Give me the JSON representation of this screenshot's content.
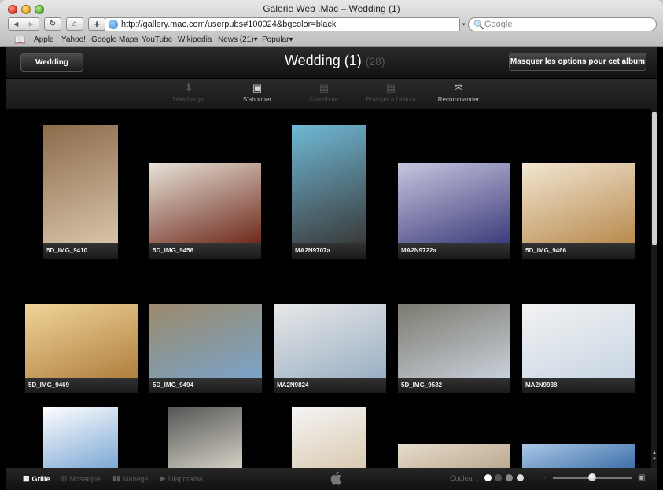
{
  "window": {
    "title": "Galerie Web .Mac – Wedding (1)"
  },
  "browser": {
    "url": "http://gallery.mac.com/userpubs#100024&bgcolor=black",
    "search_placeholder": "Google",
    "bookmarks": [
      "Apple",
      "Yahoo!",
      "Google Maps",
      "YouTube",
      "Wikipedia",
      "News (21)▾",
      "Popular▾"
    ]
  },
  "gallery": {
    "album_button": "Wedding",
    "title": "Wedding (1)",
    "count": "(28)",
    "hide_options_button": "Masquer les options pour cet album",
    "actions": [
      {
        "label": "Télécharger",
        "icon": "download-icon",
        "enabled": false
      },
      {
        "label": "S'abonner",
        "icon": "rss-icon",
        "enabled": true
      },
      {
        "label": "Contribuer",
        "icon": "contribute-icon",
        "enabled": false
      },
      {
        "label": "Envoyer à l'album",
        "icon": "send-icon",
        "enabled": false
      },
      {
        "label": "Recommander",
        "icon": "envelope-icon",
        "enabled": true
      }
    ],
    "photos": [
      {
        "caption": "5D_IMG_9410",
        "colors": [
          "#d8c4a8",
          "#8c6b4a"
        ]
      },
      {
        "caption": "5D_IMG_9456",
        "colors": [
          "#6e2a1c",
          "#e8e2d8"
        ]
      },
      {
        "caption": "MA2N9707a",
        "colors": [
          "#3a3a3a",
          "#6fb9d6"
        ]
      },
      {
        "caption": "MA2N9722a",
        "colors": [
          "#3d3c7a",
          "#c7c6e0"
        ]
      },
      {
        "caption": "5D_IMG_9466",
        "colors": [
          "#b88a4e",
          "#f2e6d2"
        ]
      },
      {
        "caption": "5D_IMG_9469",
        "colors": [
          "#b0803e",
          "#f0d49a"
        ]
      },
      {
        "caption": "5D_IMG_9494",
        "colors": [
          "#7aa3c8",
          "#9b8a6a"
        ]
      },
      {
        "caption": "MA2N9824",
        "colors": [
          "#9bb0c4",
          "#e8e8e8"
        ]
      },
      {
        "caption": "5D_IMG_9532",
        "colors": [
          "#c7cfd8",
          "#7c7a70"
        ]
      },
      {
        "caption": "MA2N9938",
        "colors": [
          "#c9d6e4",
          "#f2f2f2"
        ]
      },
      {
        "caption": "",
        "colors": [
          "#7aa6d4",
          "#ffffff"
        ]
      },
      {
        "caption": "",
        "colors": [
          "#d6d2c6",
          "#555555"
        ]
      },
      {
        "caption": "",
        "colors": [
          "#d9c9b0",
          "#f5f5f5"
        ]
      },
      {
        "caption": "",
        "colors": [
          "#b9a88e",
          "#e6dccb"
        ]
      },
      {
        "caption": "",
        "colors": [
          "#3c6ea8",
          "#a9c7e6"
        ]
      }
    ]
  },
  "bottombar": {
    "view_modes": [
      {
        "label": "Grille",
        "icon": "grid-icon",
        "active": true
      },
      {
        "label": "Mosaïque",
        "icon": "mosaic-icon",
        "active": false
      },
      {
        "label": "Manège",
        "icon": "carousel-icon",
        "active": false
      },
      {
        "label": "Diaporama",
        "icon": "slideshow-icon",
        "active": false
      }
    ],
    "color_label": "Couleur :",
    "colors": [
      "#ffffff",
      "#555555",
      "#888888",
      "#dddddd"
    ]
  }
}
